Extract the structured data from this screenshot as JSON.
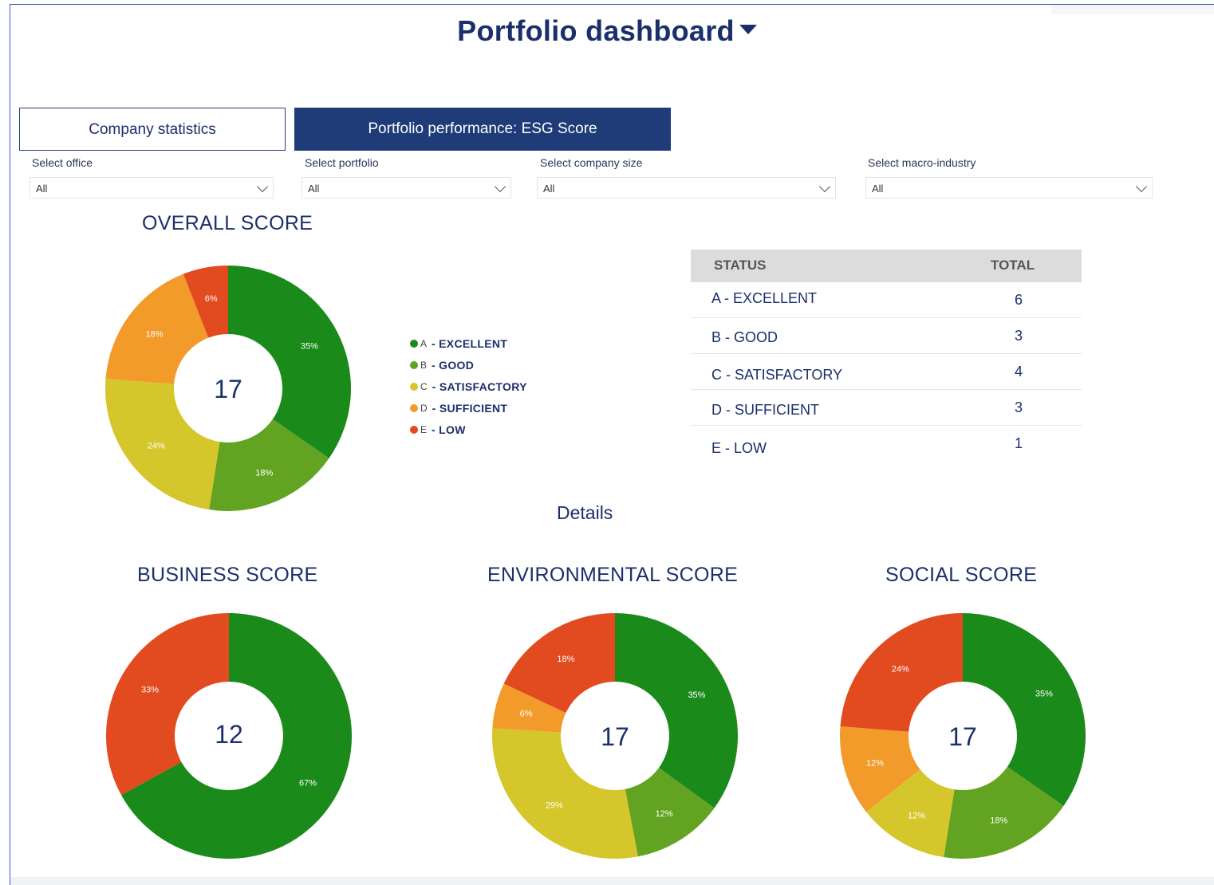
{
  "header": {
    "title": "Portfolio dashboard"
  },
  "tabs": [
    {
      "label": "Company statistics",
      "active": false
    },
    {
      "label": "Portfolio performance: ESG Score",
      "active": true
    }
  ],
  "filters": [
    {
      "label": "Select office",
      "value": "All"
    },
    {
      "label": "Select portfolio",
      "value": "All"
    },
    {
      "label": "Select company size",
      "value": "All"
    },
    {
      "label": "Select macro-industry",
      "value": "All"
    }
  ],
  "overall": {
    "title": "OVERALL SCORE",
    "total": "17"
  },
  "legend": [
    {
      "letter": "A",
      "label": "- EXCELLENT",
      "color": "#1a8a1a"
    },
    {
      "letter": "B",
      "label": "- GOOD",
      "color": "#63a322"
    },
    {
      "letter": "C",
      "label": "- SATISFACTORY",
      "color": "#d5c62b"
    },
    {
      "letter": "D",
      "label": "- SUFFICIENT",
      "color": "#f29b2a"
    },
    {
      "letter": "E",
      "label": "- LOW",
      "color": "#e24a1f"
    }
  ],
  "status_table": {
    "headers": [
      "STATUS",
      "TOTAL"
    ],
    "rows": [
      {
        "status": "A - EXCELLENT",
        "total": "6"
      },
      {
        "status": "B - GOOD",
        "total": "3"
      },
      {
        "status": "C - SATISFACTORY",
        "total": "4"
      },
      {
        "status": "D - SUFFICIENT",
        "total": "3"
      },
      {
        "status": "E - LOW",
        "total": "1"
      }
    ]
  },
  "details_label": "Details",
  "business": {
    "title": "BUSINESS SCORE",
    "total": "12"
  },
  "environmental": {
    "title": "ENVIRONMENTAL SCORE",
    "total": "17"
  },
  "social": {
    "title": "SOCIAL SCORE",
    "total": "17"
  },
  "chart_data": [
    {
      "type": "pie",
      "title": "OVERALL SCORE",
      "categories": [
        "A - EXCELLENT",
        "B - GOOD",
        "C - SATISFACTORY",
        "D - SUFFICIENT",
        "E - LOW"
      ],
      "values": [
        35,
        18,
        24,
        18,
        6
      ],
      "labels": [
        "35%",
        "18%",
        "24%",
        "18%",
        "6%"
      ],
      "colors": [
        "#1a8a1a",
        "#63a322",
        "#d5c62b",
        "#f29b2a",
        "#e24a1f"
      ],
      "center": "17"
    },
    {
      "type": "pie",
      "title": "BUSINESS SCORE",
      "categories": [
        "A - EXCELLENT",
        "E - LOW"
      ],
      "values": [
        67,
        33
      ],
      "labels": [
        "67%",
        "33%"
      ],
      "colors": [
        "#1a8a1a",
        "#e24a1f"
      ],
      "center": "12"
    },
    {
      "type": "pie",
      "title": "ENVIRONMENTAL SCORE",
      "categories": [
        "A - EXCELLENT",
        "B - GOOD",
        "C - SATISFACTORY",
        "D - SUFFICIENT",
        "E - LOW"
      ],
      "values": [
        35,
        12,
        29,
        6,
        18
      ],
      "labels": [
        "35%",
        "12%",
        "29%",
        "6%",
        "18%"
      ],
      "colors": [
        "#1a8a1a",
        "#63a322",
        "#d5c62b",
        "#f29b2a",
        "#e24a1f"
      ],
      "center": "17"
    },
    {
      "type": "pie",
      "title": "SOCIAL SCORE",
      "categories": [
        "A - EXCELLENT",
        "B - GOOD",
        "C - SATISFACTORY",
        "D - SUFFICIENT",
        "E - LOW"
      ],
      "values": [
        35,
        18,
        12,
        12,
        24
      ],
      "labels": [
        "35%",
        "18%",
        "12%",
        "12%",
        "24%"
      ],
      "colors": [
        "#1a8a1a",
        "#63a322",
        "#d5c62b",
        "#f29b2a",
        "#e24a1f"
      ],
      "center": "17"
    }
  ]
}
